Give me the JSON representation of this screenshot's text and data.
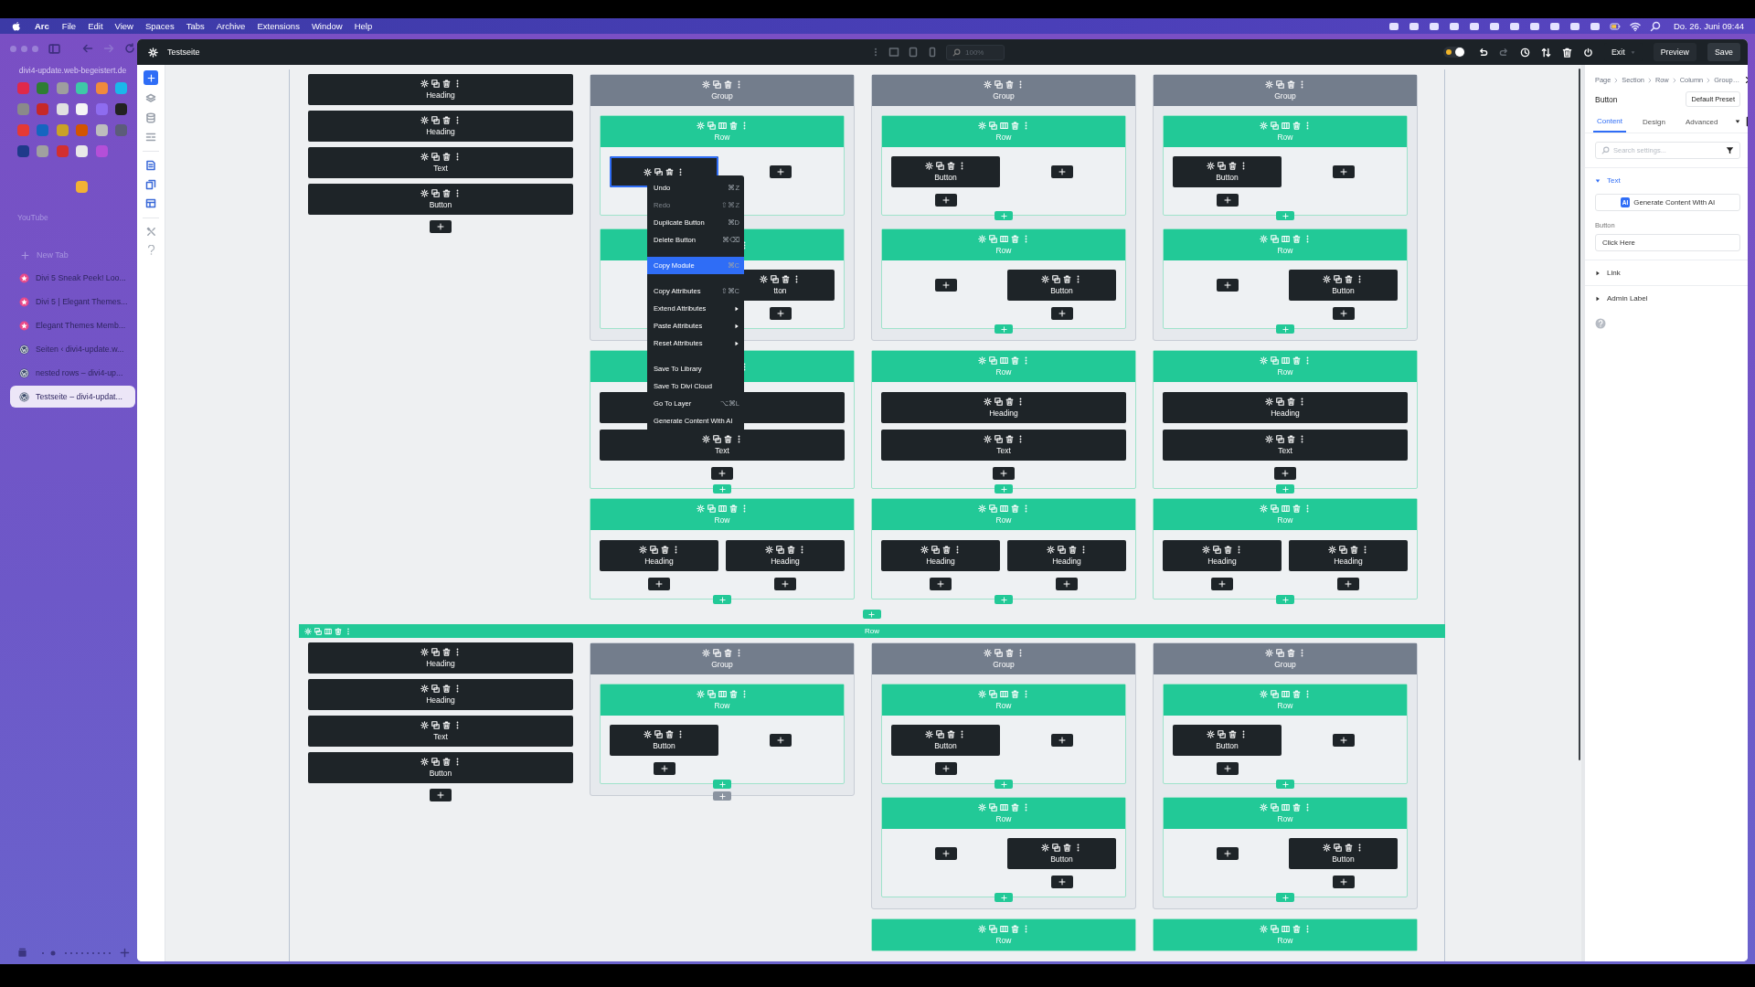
{
  "menu_bar": {
    "app": "Arc",
    "items": [
      "File",
      "Edit",
      "View",
      "Spaces",
      "Tabs",
      "Archive",
      "Extensions",
      "Window",
      "Help"
    ],
    "clock": "Do. 26. Juni 09:44"
  },
  "browser_sidebar": {
    "url": "divi4-update.web-begeistert.de",
    "pinned": [
      {
        "color": "#e0294a"
      },
      {
        "color": "#2e7d32"
      },
      {
        "color": "#9e9e9e"
      },
      {
        "color": "#3ec9a7"
      },
      {
        "color": "#f08a3c"
      },
      {
        "color": "#1ab7ea"
      },
      {
        "color": "#8a8a8a"
      },
      {
        "color": "#c62828"
      },
      {
        "color": "#e0e0e0"
      },
      {
        "color": "#f5f5f5"
      },
      {
        "color": "#8e6cf0"
      },
      {
        "color": "#222222"
      },
      {
        "color": "#e53935"
      },
      {
        "color": "#1565c0"
      },
      {
        "color": "#c9a227"
      },
      {
        "color": "#d35400"
      },
      {
        "color": "#bdbdbd"
      },
      {
        "color": "#5c5c7a"
      },
      {
        "color": "#1e3a8a"
      },
      {
        "color": "#a0a0a0"
      },
      {
        "color": "#d32f2f"
      },
      {
        "color": "#e8e8e8"
      },
      {
        "color": "#b44fd8"
      },
      {
        "color": "#f2b134"
      }
    ],
    "folder": "YouTube",
    "new_tab": "New Tab",
    "tabs": [
      {
        "title": "Divi 5 Sneak Peek! Loo...",
        "kind": "star",
        "selected": false
      },
      {
        "title": "Divi 5 | Elegant Themes...",
        "kind": "star",
        "selected": false
      },
      {
        "title": "Elegant Themes Memb...",
        "kind": "star",
        "selected": false
      },
      {
        "title": "Seiten ‹ divi4-update.w...",
        "kind": "wordpress",
        "selected": false
      },
      {
        "title": "nested rows – divi4-up...",
        "kind": "wordpress",
        "selected": false
      },
      {
        "title": "Testseite – divi4-updat...",
        "kind": "wordpress",
        "selected": true
      }
    ]
  },
  "builder": {
    "page_title": "Testseite",
    "zoom": {
      "placeholder": "100%"
    },
    "exit": "Exit",
    "preview": "Preview",
    "save": "Save"
  },
  "canvas": {
    "rows": [
      {
        "columns": [
          {
            "items": [
              {
                "kind": "module",
                "label": "Heading"
              },
              {
                "kind": "module",
                "label": "Heading"
              },
              {
                "kind": "module",
                "label": "Text"
              },
              {
                "kind": "module",
                "label": "Button"
              }
            ]
          },
          {
            "items": [
              {
                "kind": "group",
                "label": "Group",
                "rows": [
                  {
                    "label": "Row",
                    "columns": [
                      {
                        "modules": [
                          {
                            "selected": true
                          }
                        ]
                      },
                      {}
                    ]
                  },
                  {
                    "columns": [
                      {},
                      {
                        "modules": [
                          {
                            "label": "tton"
                          }
                        ]
                      }
                    ]
                  }
                ]
              },
              {
                "kind": "row",
                "columns": [
                  {
                    "modules": [
                      {
                        "selected": false
                      },
                      {
                        "label": "Text"
                      }
                    ]
                  }
                ]
              },
              {
                "kind": "row",
                "label": "Row",
                "columns": [
                  {
                    "modules": [
                      {
                        "label": "Heading"
                      }
                    ]
                  },
                  {
                    "modules": [
                      {
                        "label": "Heading"
                      }
                    ]
                  }
                ]
              }
            ]
          },
          {
            "items": [
              {
                "kind": "group",
                "label": "Group",
                "add_button": false,
                "rows": [
                  {
                    "label": "Row",
                    "columns": [
                      {
                        "modules": [
                          {
                            "label": "Button"
                          }
                        ]
                      },
                      {}
                    ]
                  },
                  {
                    "label": "Row",
                    "columns": [
                      {},
                      {
                        "modules": [
                          {
                            "label": "Button"
                          }
                        ]
                      }
                    ]
                  }
                ]
              },
              {
                "kind": "row",
                "label": "Row",
                "columns": [
                  {
                    "modules": [
                      {
                        "label": "Heading"
                      },
                      {
                        "label": "Text"
                      }
                    ]
                  }
                ]
              },
              {
                "kind": "row",
                "label": "Row",
                "columns": [
                  {
                    "modules": [
                      {
                        "label": "Heading"
                      }
                    ]
                  },
                  {
                    "modules": [
                      {
                        "label": "Heading"
                      }
                    ]
                  }
                ]
              }
            ]
          },
          {
            "items": [
              {
                "kind": "group",
                "label": "Group",
                "add_button": false,
                "rows": [
                  {
                    "label": "Row",
                    "columns": [
                      {
                        "modules": [
                          {
                            "label": "Button"
                          }
                        ]
                      },
                      {}
                    ]
                  },
                  {
                    "label": "Row",
                    "columns": [
                      {},
                      {
                        "modules": [
                          {
                            "label": "Button"
                          }
                        ]
                      }
                    ]
                  }
                ]
              },
              {
                "kind": "row",
                "label": "Row",
                "columns": [
                  {
                    "modules": [
                      {
                        "label": "Heading"
                      },
                      {
                        "label": "Text"
                      }
                    ]
                  }
                ]
              },
              {
                "kind": "row",
                "label": "Row",
                "columns": [
                  {
                    "modules": [
                      {
                        "label": "Heading"
                      }
                    ]
                  },
                  {
                    "modules": [
                      {
                        "label": "Heading"
                      }
                    ]
                  }
                ]
              }
            ]
          }
        ]
      },
      {
        "label": "Row",
        "columns": [
          {
            "items": [
              {
                "kind": "module",
                "label": "Heading"
              },
              {
                "kind": "module",
                "label": "Heading"
              },
              {
                "kind": "module",
                "label": "Text"
              },
              {
                "kind": "module",
                "label": "Button"
              }
            ]
          },
          {
            "items": [
              {
                "kind": "group",
                "label": "Group",
                "add_button": true,
                "rows": [
                  {
                    "label": "Row",
                    "columns": [
                      {
                        "modules": [
                          {
                            "label": "Button"
                          }
                        ]
                      },
                      {}
                    ]
                  }
                ]
              }
            ]
          },
          {
            "items": [
              {
                "kind": "group",
                "label": "Group",
                "add_button": false,
                "rows": [
                  {
                    "label": "Row",
                    "columns": [
                      {
                        "modules": [
                          {
                            "label": "Button"
                          }
                        ]
                      },
                      {}
                    ]
                  },
                  {
                    "label": "Row",
                    "columns": [
                      {},
                      {
                        "modules": [
                          {
                            "label": "Button"
                          }
                        ]
                      }
                    ]
                  }
                ]
              },
              {
                "kind": "row",
                "label": "Row"
              }
            ]
          },
          {
            "items": [
              {
                "kind": "group",
                "label": "Group",
                "add_button": false,
                "rows": [
                  {
                    "label": "Row",
                    "columns": [
                      {
                        "modules": [
                          {
                            "label": "Button"
                          }
                        ]
                      },
                      {}
                    ]
                  },
                  {
                    "label": "Row",
                    "columns": [
                      {},
                      {
                        "modules": [
                          {
                            "label": "Button"
                          }
                        ]
                      }
                    ]
                  }
                ]
              },
              {
                "kind": "row",
                "label": "Row"
              }
            ]
          }
        ]
      }
    ],
    "context_menu": {
      "groups": [
        [
          {
            "label": "Undo",
            "shortcut": "⌘Z",
            "disabled": false,
            "submenu": false,
            "selected": false
          },
          {
            "label": "Redo",
            "shortcut": "⇧⌘Z",
            "disabled": true,
            "submenu": false,
            "selected": false
          },
          {
            "label": "Duplicate Button",
            "shortcut": "⌘D",
            "disabled": false,
            "submenu": false,
            "selected": false
          },
          {
            "label": "Delete Button",
            "shortcut": "⌘⌫",
            "disabled": false,
            "submenu": false,
            "selected": false
          }
        ],
        [
          {
            "label": "Copy Module",
            "shortcut": "⌘C",
            "disabled": false,
            "submenu": false,
            "selected": true
          }
        ],
        [
          {
            "label": "Copy Attributes",
            "shortcut": "⇧⌘C",
            "disabled": false,
            "submenu": false,
            "selected": false
          },
          {
            "label": "Extend Attributes",
            "disabled": false,
            "submenu": true,
            "selected": false
          },
          {
            "label": "Paste Attributes",
            "disabled": false,
            "submenu": true,
            "selected": false
          },
          {
            "label": "Reset Attributes",
            "disabled": false,
            "submenu": true,
            "selected": false
          }
        ],
        [
          {
            "label": "Save To Library",
            "disabled": false,
            "submenu": false,
            "selected": false
          },
          {
            "label": "Save To Divi Cloud",
            "disabled": false,
            "submenu": false,
            "selected": false
          },
          {
            "label": "Go To Layer",
            "shortcut": "⌥⌘L",
            "disabled": false,
            "submenu": false,
            "selected": false
          },
          {
            "label": "Generate Content With AI",
            "disabled": false,
            "submenu": false,
            "selected": false
          }
        ]
      ]
    }
  },
  "settings_panel": {
    "breadcrumb": [
      "Page",
      "Section",
      "Row",
      "Column",
      "Group…"
    ],
    "title": "Button",
    "preset": "Default Preset",
    "tabs": [
      {
        "label": "Content",
        "selected": true
      },
      {
        "label": "Design",
        "selected": false
      },
      {
        "label": "Advanced",
        "selected": false
      }
    ],
    "search": {
      "placeholder": "Search settings..."
    },
    "groups": [
      {
        "label": "Text",
        "expanded": true,
        "ai_badge": "AI",
        "ai_button": "Generate Content With AI",
        "field_label": "Button",
        "field_value": "Click Here"
      },
      {
        "label": "Link",
        "expanded": false
      },
      {
        "label": "Admin Label",
        "expanded": false
      }
    ]
  }
}
